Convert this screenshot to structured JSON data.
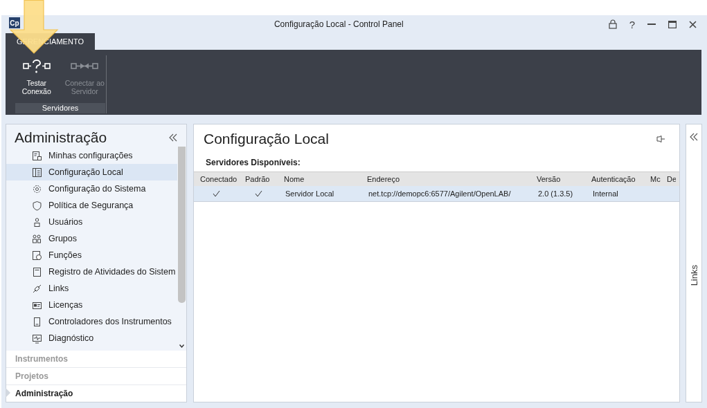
{
  "window": {
    "logo": "Cp",
    "title": "Configuração Local - Control Panel",
    "help": "?"
  },
  "ribbon": {
    "tabs": [
      {
        "label": "GERENCIAMENTO",
        "selected": true
      }
    ],
    "group": {
      "label": "Servidores",
      "buttons": [
        {
          "label": "Testar Conexão",
          "disabled": false,
          "kind": "test"
        },
        {
          "label": "Conectar ao Servidor",
          "disabled": true,
          "kind": "connect"
        }
      ]
    }
  },
  "sidebar": {
    "title": "Administração",
    "items": [
      {
        "label": "Minhas configurações",
        "selected": false
      },
      {
        "label": "Configuração Local",
        "selected": true
      },
      {
        "label": "Configuração do Sistema",
        "selected": false
      },
      {
        "label": "Política de Segurança",
        "selected": false
      },
      {
        "label": "Usuários",
        "selected": false
      },
      {
        "label": "Grupos",
        "selected": false
      },
      {
        "label": "Funções",
        "selected": false
      },
      {
        "label": "Registro de Atividades do Sistem",
        "selected": false
      },
      {
        "label": "Links",
        "selected": false
      },
      {
        "label": "Licenças",
        "selected": false
      },
      {
        "label": "Controladores dos Instrumentos",
        "selected": false
      },
      {
        "label": "Diagnóstico",
        "selected": false
      }
    ],
    "sections": [
      {
        "label": "Instrumentos",
        "selected": false
      },
      {
        "label": "Projetos",
        "selected": false
      },
      {
        "label": "Administração",
        "selected": true
      }
    ]
  },
  "content": {
    "title": "Configuração Local",
    "subtitle": "Servidores Disponíveis:",
    "table": {
      "columns": [
        "Conectado",
        "Padrão",
        "Nome",
        "Endereço",
        "Versão",
        "Autenticação",
        "Mc",
        "De"
      ],
      "rows": [
        {
          "selected": true,
          "connected": true,
          "default": true,
          "name": "Servidor Local",
          "address": "net.tcp://demopc6:6577/Agilent/OpenLAB/",
          "version": "2.0 (1.3.5)",
          "auth": "Internal"
        }
      ]
    }
  },
  "links_panel": {
    "label": "Links"
  }
}
